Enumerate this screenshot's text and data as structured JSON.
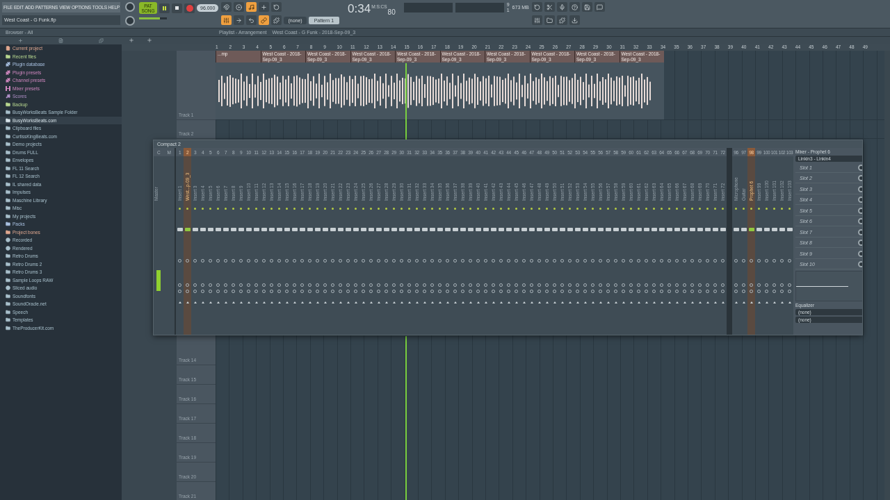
{
  "menu": [
    "FILE",
    "EDIT",
    "ADD",
    "PATTERNS",
    "VIEW",
    "OPTIONS",
    "TOOLS",
    "HELP"
  ],
  "song_file": "West Coast - G Funk.flp",
  "transport": {
    "mode_top": "PAT",
    "mode": "SONG",
    "song_mode": true,
    "tempo": "96.000"
  },
  "master_volume": {
    "level": 0.75
  },
  "time": {
    "value": "0:34",
    "sub": "80",
    "unit": "M:S:CS"
  },
  "readouts": {
    "readout_1": "9",
    "readout_2": "1",
    "memory": "673 MB"
  },
  "pattern": {
    "channel": "(none)",
    "name": "Pattern 1"
  },
  "browser": {
    "title": "Browser - All",
    "items": [
      {
        "label": "Current project",
        "kind": "project",
        "color": "#e0a890",
        "selected": false
      },
      {
        "label": "Recent files",
        "kind": "recent",
        "color": "#b8d890",
        "selected": false
      },
      {
        "label": "Plugin database",
        "kind": "plugin",
        "color": "#a8c0e0",
        "selected": false
      },
      {
        "label": "Plugin presets",
        "kind": "plugin",
        "color": "#d088c0",
        "selected": false
      },
      {
        "label": "Channel presets",
        "kind": "channel",
        "color": "#d088c0",
        "selected": false
      },
      {
        "label": "Mixer presets",
        "kind": "mixer",
        "color": "#d088c0",
        "selected": false
      },
      {
        "label": "Scores",
        "kind": "note",
        "color": "#b090c8",
        "selected": false
      },
      {
        "label": "Backup",
        "kind": "recent",
        "color": "#b8d890",
        "selected": false
      },
      {
        "label": "BusyWorksBeats Sample Folder",
        "kind": "folder",
        "color": "#a8c0cc",
        "selected": false
      },
      {
        "label": "BusyWorksBeats.com",
        "kind": "folder",
        "color": "#d8e4ea",
        "selected": true
      },
      {
        "label": "Clipboard files",
        "kind": "folder",
        "color": "#a8c0cc",
        "selected": false
      },
      {
        "label": "CurtissKingBeats.com",
        "kind": "folder",
        "color": "#a8c0cc",
        "selected": false
      },
      {
        "label": "Demo projects",
        "kind": "folder",
        "color": "#a8c0cc",
        "selected": false
      },
      {
        "label": "Drums FULL",
        "kind": "folder",
        "color": "#a8c0cc",
        "selected": false
      },
      {
        "label": "Envelopes",
        "kind": "folder",
        "color": "#a8c0cc",
        "selected": false
      },
      {
        "label": "FL 11 Search",
        "kind": "folder",
        "color": "#a8c0cc",
        "selected": false
      },
      {
        "label": "FL 12 Search",
        "kind": "folder",
        "color": "#a8c0cc",
        "selected": false
      },
      {
        "label": "IL shared data",
        "kind": "folder",
        "color": "#a8c0cc",
        "selected": false
      },
      {
        "label": "Impulses",
        "kind": "folder",
        "color": "#a8c0cc",
        "selected": false
      },
      {
        "label": "Maschine Library",
        "kind": "folder",
        "color": "#a8c0cc",
        "selected": false
      },
      {
        "label": "Misc",
        "kind": "folder",
        "color": "#a8c0cc",
        "selected": false
      },
      {
        "label": "My projects",
        "kind": "folder",
        "color": "#a8c0cc",
        "selected": false
      },
      {
        "label": "Packs",
        "kind": "packs",
        "color": "#a8c0e0",
        "selected": false
      },
      {
        "label": "Project bones",
        "kind": "folder",
        "color": "#e0a890",
        "selected": false
      },
      {
        "label": "Recorded",
        "kind": "audio",
        "color": "#a8c0cc",
        "selected": false
      },
      {
        "label": "Rendered",
        "kind": "audio",
        "color": "#a8c0cc",
        "selected": false
      },
      {
        "label": "Retro Drums",
        "kind": "folder",
        "color": "#a8c0cc",
        "selected": false
      },
      {
        "label": "Retro Drums 2",
        "kind": "folder",
        "color": "#a8c0cc",
        "selected": false
      },
      {
        "label": "Retro Drums 3",
        "kind": "folder",
        "color": "#a8c0cc",
        "selected": false
      },
      {
        "label": "Sample Loops RAW",
        "kind": "folder",
        "color": "#a8c0cc",
        "selected": false
      },
      {
        "label": "Sliced audio",
        "kind": "audio",
        "color": "#a8c0cc",
        "selected": false
      },
      {
        "label": "Soundfonts",
        "kind": "folder",
        "color": "#a8c0cc",
        "selected": false
      },
      {
        "label": "SoundOracle.net",
        "kind": "folder",
        "color": "#a8c0cc",
        "selected": false
      },
      {
        "label": "Speech",
        "kind": "folder",
        "color": "#a8c0cc",
        "selected": false
      },
      {
        "label": "Templates",
        "kind": "folder",
        "color": "#a8c0cc",
        "selected": false
      },
      {
        "label": "TheProducerKit.com",
        "kind": "folder",
        "color": "#a8c0cc",
        "selected": false
      }
    ]
  },
  "playlist": {
    "breadcrumb": [
      "Playlist - Arrangement",
      "West Coast - G Funk - 2018-Sep-09_3"
    ],
    "bars": [
      "1",
      "2",
      "3",
      "4",
      "5",
      "6",
      "7",
      "8",
      "9",
      "10",
      "11",
      "12",
      "13",
      "14",
      "15",
      "16",
      "17",
      "18",
      "19",
      "20",
      "21",
      "22",
      "23",
      "24",
      "25",
      "26",
      "27",
      "28",
      "29",
      "30",
      "31",
      "32",
      "33",
      "34",
      "35",
      "36",
      "37",
      "38",
      "39",
      "40",
      "41",
      "42",
      "43",
      "44",
      "45",
      "46",
      "47",
      "48",
      "49"
    ],
    "top_tracks": [
      {
        "name": "Track 1",
        "clips": [
          "...mp",
          "West Coast - 2018-Sep-09_3",
          "West Coast - 2018-Sep-09_3",
          "West Coast - 2018-Sep-09_3",
          "West Coast - 2018-Sep-09_3",
          "West Coast - 2018-Sep-09_3",
          "West Coast - 2018-Sep-09_3",
          "West Coast - 2018-Sep-09_3",
          "West Coast - 2018-Sep-09_3",
          "West Coast - 2018-Sep-09_3"
        ]
      },
      {
        "name": "Track 2"
      }
    ],
    "bottom_tracks": [
      "Track 14",
      "Track 15",
      "Track 16",
      "Track 17",
      "Track 18",
      "Track 19",
      "Track 20",
      "Track 21"
    ]
  },
  "mixer": {
    "title": "Compact 2",
    "master": {
      "head_1": "C",
      "head_2": "M",
      "label": "Master"
    },
    "strips": [
      {
        "number": "1",
        "label": "Insert 1",
        "selected": false
      },
      {
        "number": "2",
        "label": "West...p-09_3",
        "selected": true
      },
      {
        "number": "3",
        "label": "Insert 3",
        "selected": false
      },
      {
        "number": "4",
        "label": "Insert 4",
        "selected": false
      },
      {
        "number": "5",
        "label": "Insert 5",
        "selected": false
      },
      {
        "number": "6",
        "label": "Insert 6",
        "selected": false
      },
      {
        "number": "7",
        "label": "Insert 7",
        "selected": false
      },
      {
        "number": "8",
        "label": "Insert 8",
        "selected": false
      },
      {
        "number": "9",
        "label": "Insert 9",
        "selected": false
      },
      {
        "number": "10",
        "label": "Insert 10",
        "selected": false
      },
      {
        "number": "11",
        "label": "Insert 11",
        "selected": false
      },
      {
        "number": "12",
        "label": "Insert 12",
        "selected": false
      },
      {
        "number": "13",
        "label": "Insert 13",
        "selected": false
      },
      {
        "number": "14",
        "label": "Insert 14",
        "selected": false
      },
      {
        "number": "15",
        "label": "Insert 15",
        "selected": false
      },
      {
        "number": "16",
        "label": "Insert 16",
        "selected": false
      },
      {
        "number": "17",
        "label": "Insert 17",
        "selected": false
      },
      {
        "number": "18",
        "label": "Insert 18",
        "selected": false
      },
      {
        "number": "19",
        "label": "Insert 19",
        "selected": false
      },
      {
        "number": "20",
        "label": "Insert 20",
        "selected": false
      },
      {
        "number": "21",
        "label": "Insert 21",
        "selected": false
      },
      {
        "number": "22",
        "label": "Insert 22",
        "selected": false
      },
      {
        "number": "23",
        "label": "Insert 23",
        "selected": false
      },
      {
        "number": "24",
        "label": "Insert 24",
        "selected": false
      },
      {
        "number": "25",
        "label": "Insert 25",
        "selected": false
      },
      {
        "number": "26",
        "label": "Insert 26",
        "selected": false
      },
      {
        "number": "27",
        "label": "Insert 27",
        "selected": false
      },
      {
        "number": "28",
        "label": "Insert 28",
        "selected": false
      },
      {
        "number": "29",
        "label": "Insert 29",
        "selected": false
      },
      {
        "number": "30",
        "label": "Insert 30",
        "selected": false
      },
      {
        "number": "31",
        "label": "Insert 31",
        "selected": false
      },
      {
        "number": "32",
        "label": "Insert 32",
        "selected": false
      },
      {
        "number": "33",
        "label": "Insert 33",
        "selected": false
      },
      {
        "number": "34",
        "label": "Insert 34",
        "selected": false
      },
      {
        "number": "35",
        "label": "Insert 35",
        "selected": false
      },
      {
        "number": "36",
        "label": "Insert 36",
        "selected": false
      },
      {
        "number": "37",
        "label": "Insert 37",
        "selected": false
      },
      {
        "number": "38",
        "label": "Insert 38",
        "selected": false
      },
      {
        "number": "39",
        "label": "Insert 39",
        "selected": false
      },
      {
        "number": "40",
        "label": "Insert 40",
        "selected": false
      },
      {
        "number": "41",
        "label": "Insert 41",
        "selected": false
      },
      {
        "number": "42",
        "label": "Insert 42",
        "selected": false
      },
      {
        "number": "43",
        "label": "Insert 43",
        "selected": false
      },
      {
        "number": "44",
        "label": "Insert 44",
        "selected": false
      },
      {
        "number": "45",
        "label": "Insert 45",
        "selected": false
      },
      {
        "number": "46",
        "label": "Insert 46",
        "selected": false
      },
      {
        "number": "47",
        "label": "Insert 47",
        "selected": false
      },
      {
        "number": "48",
        "label": "Insert 48",
        "selected": false
      },
      {
        "number": "49",
        "label": "Insert 49",
        "selected": false
      },
      {
        "number": "50",
        "label": "Insert 50",
        "selected": false
      },
      {
        "number": "51",
        "label": "Insert 51",
        "selected": false
      },
      {
        "number": "52",
        "label": "Insert 52",
        "selected": false
      },
      {
        "number": "53",
        "label": "Insert 53",
        "selected": false
      },
      {
        "number": "54",
        "label": "Insert 54",
        "selected": false
      },
      {
        "number": "55",
        "label": "Insert 55",
        "selected": false
      },
      {
        "number": "56",
        "label": "Insert 56",
        "selected": false
      },
      {
        "number": "57",
        "label": "Insert 57",
        "selected": false
      },
      {
        "number": "58",
        "label": "Insert 58",
        "selected": false
      },
      {
        "number": "59",
        "label": "Insert 59",
        "selected": false
      },
      {
        "number": "60",
        "label": "Insert 60",
        "selected": false
      },
      {
        "number": "61",
        "label": "Insert 61",
        "selected": false
      },
      {
        "number": "62",
        "label": "Insert 62",
        "selected": false
      },
      {
        "number": "63",
        "label": "Insert 63",
        "selected": false
      },
      {
        "number": "64",
        "label": "Insert 64",
        "selected": false
      },
      {
        "number": "65",
        "label": "Insert 65",
        "selected": false
      },
      {
        "number": "66",
        "label": "Insert 66",
        "selected": false
      },
      {
        "number": "67",
        "label": "Insert 67",
        "selected": false
      },
      {
        "number": "68",
        "label": "Insert 68",
        "selected": false
      },
      {
        "number": "69",
        "label": "Insert 69",
        "selected": false
      },
      {
        "number": "70",
        "label": "Insert 70",
        "selected": false
      },
      {
        "number": "71",
        "label": "Insert 71",
        "selected": false
      },
      {
        "number": "72",
        "label": "Insert 72",
        "selected": false
      }
    ],
    "extra_strips": [
      {
        "number": "96",
        "label": "Microphone",
        "selected": false
      },
      {
        "number": "97",
        "label": "Guitar",
        "selected": false
      },
      {
        "number": "98",
        "label": "Prophet 6",
        "selected": true
      },
      {
        "number": "99",
        "label": "Insert 99",
        "selected": false
      },
      {
        "number": "100",
        "label": "Insert 100",
        "selected": false
      },
      {
        "number": "101",
        "label": "Insert 101",
        "selected": false
      },
      {
        "number": "102",
        "label": "Insert 102",
        "selected": false
      },
      {
        "number": "103",
        "label": "Insert 103",
        "selected": false
      }
    ],
    "panel": {
      "title": "Mixer - Prophet 6",
      "input": "Linkin3 - Linkin4",
      "slots": [
        "Slot 1",
        "Slot 2",
        "Slot 3",
        "Slot 4",
        "Slot 5",
        "Slot 6",
        "Slot 7",
        "Slot 8",
        "Slot 9",
        "Slot 10"
      ],
      "eq_label": "Equalizer",
      "send_1": "(none)",
      "send_2": "(none)"
    }
  }
}
